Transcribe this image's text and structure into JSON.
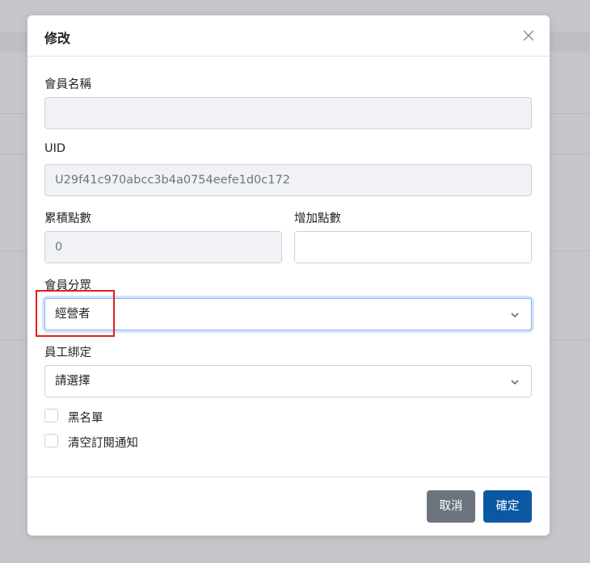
{
  "modal": {
    "title": "修改",
    "fields": {
      "member_name": {
        "label": "會員名稱",
        "value": ""
      },
      "uid": {
        "label": "UID",
        "value": "U29f41c970abcc3b4a0754eefe1d0c172"
      },
      "accumulated_points": {
        "label": "累積點數",
        "value": "0"
      },
      "add_points": {
        "label": "增加點數",
        "value": ""
      },
      "member_group": {
        "label": "會員分眾",
        "selected": "經營者"
      },
      "staff_binding": {
        "label": "員工綁定",
        "selected": "請選擇"
      }
    },
    "checkboxes": {
      "blacklist": {
        "label": "黑名單",
        "checked": false
      },
      "clear_subscription": {
        "label": "清空訂閱通知",
        "checked": false
      }
    },
    "buttons": {
      "cancel": "取消",
      "confirm": "確定"
    }
  },
  "colors": {
    "primary": "#0b57a4",
    "secondary": "#6c757d",
    "annotation": "#e02020"
  }
}
